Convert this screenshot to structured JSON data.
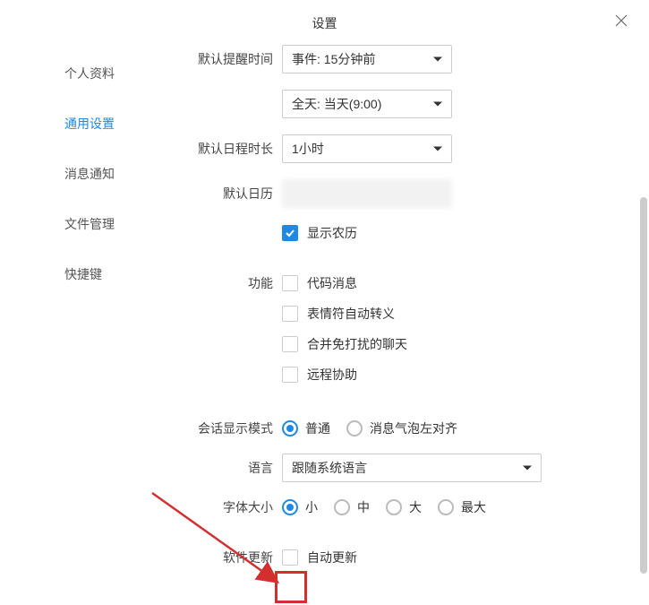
{
  "title": "设置",
  "sidebar": {
    "items": [
      {
        "label": "个人资料"
      },
      {
        "label": "通用设置"
      },
      {
        "label": "消息通知"
      },
      {
        "label": "文件管理"
      },
      {
        "label": "快捷键"
      }
    ],
    "active_index": 1
  },
  "labels": {
    "default_reminder": "默认提醒时间",
    "default_duration": "默认日程时长",
    "default_calendar": "默认日历",
    "features": "功能",
    "session_display_mode": "会话显示模式",
    "language": "语言",
    "font_size": "字体大小",
    "software_update": "软件更新"
  },
  "selects": {
    "reminder_event": "事件: 15分钟前",
    "reminder_allday": "全天: 当天(9:00)",
    "duration": "1小时",
    "language": "跟随系统语言"
  },
  "checkboxes": {
    "show_lunar": "显示农历",
    "code_message": "代码消息",
    "emoji_auto": "表情符自动转义",
    "merge_dnd": "合并免打扰的聊天",
    "remote_assist": "远程协助",
    "auto_update": "自动更新"
  },
  "radios": {
    "display_normal": "普通",
    "display_bubble_left": "消息气泡左对齐",
    "font_small": "小",
    "font_medium": "中",
    "font_large": "大",
    "font_xlarge": "最大"
  }
}
